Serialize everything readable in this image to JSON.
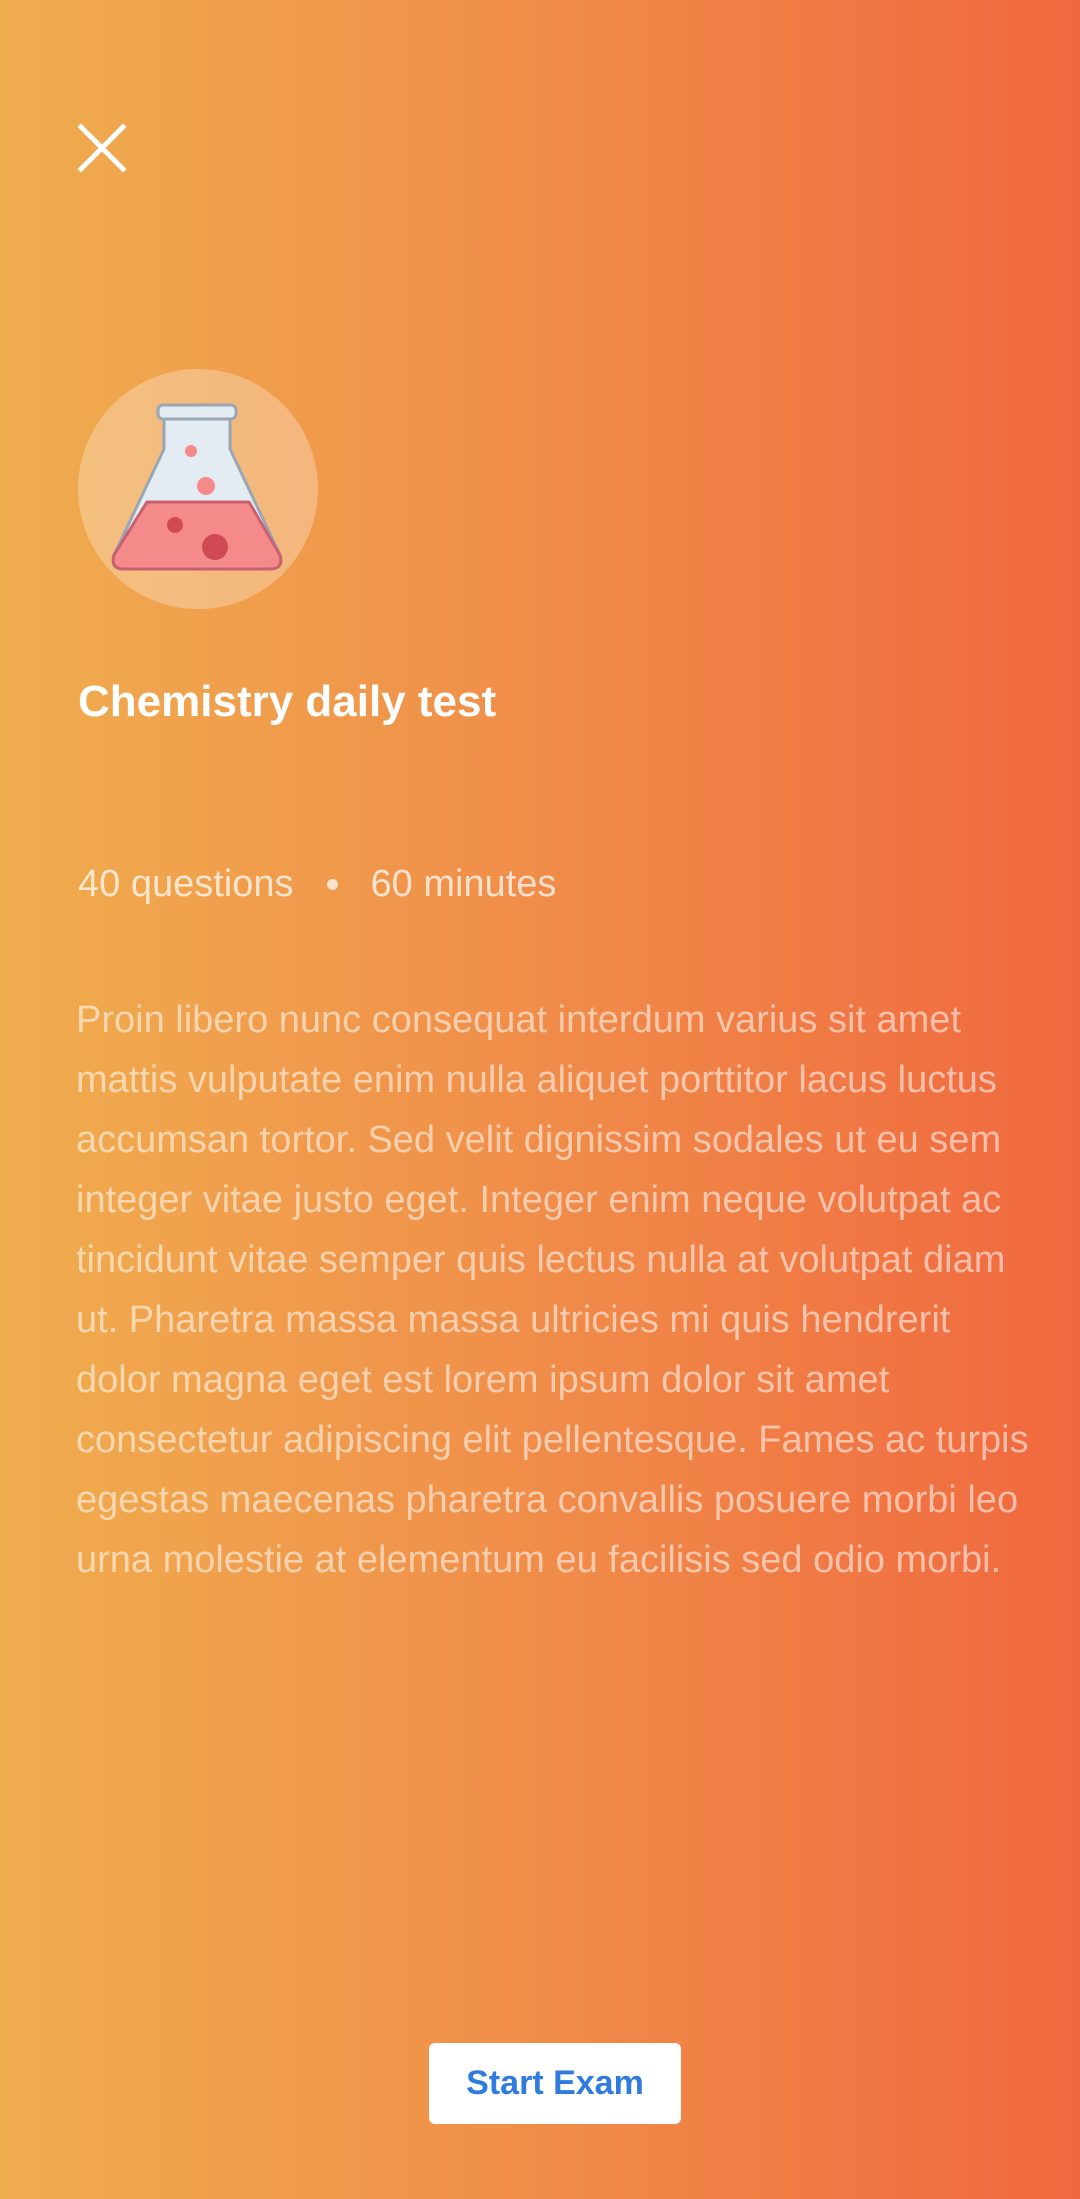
{
  "header": {
    "close_icon": "close-icon"
  },
  "exam": {
    "icon": "flask-icon",
    "title": "Chemistry daily test",
    "questions": "40 questions",
    "duration": "60 minutes",
    "description": "Proin libero nunc consequat interdum varius sit amet mattis vulputate enim nulla aliquet porttitor lacus luctus accumsan tortor. Sed velit dignissim sodales ut eu sem integer vitae justo eget. Integer enim neque volutpat ac tincidunt vitae semper quis lectus nulla at volutpat diam ut. Pharetra massa massa ultricies mi quis hendrerit dolor magna eget est lorem ipsum dolor sit amet consectetur adipiscing elit pellentesque. Fames ac turpis egestas maecenas pharetra convallis posuere morbi leo urna molestie at elementum eu facilisis sed odio morbi."
  },
  "actions": {
    "start_label": "Start Exam"
  },
  "colors": {
    "gradient_start": "#F0AD4E",
    "gradient_end": "#F0683F",
    "button_text": "#2F7BE0",
    "flask_liquid": "#F48A8A",
    "flask_glass": "#E4ECF3"
  }
}
